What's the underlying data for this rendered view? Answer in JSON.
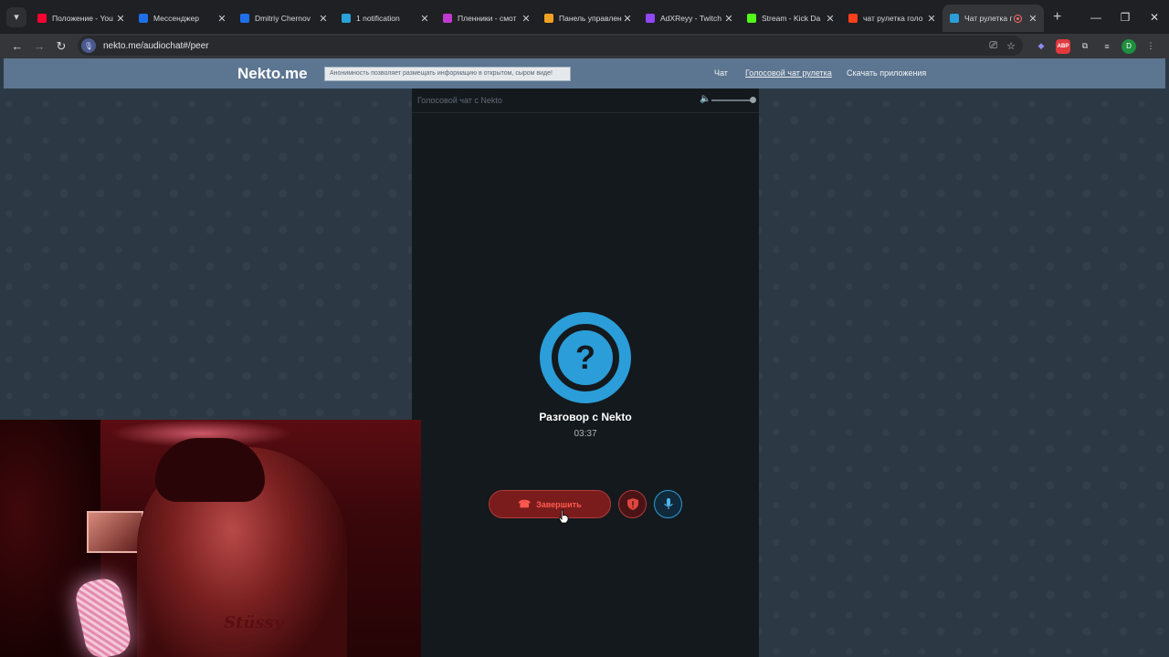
{
  "browser": {
    "tabs": [
      {
        "title": "Положение - You",
        "icon": "youtube-icon",
        "color": "#ff0033"
      },
      {
        "title": "Мессенджер",
        "icon": "messenger-icon",
        "color": "#1f6feb"
      },
      {
        "title": "Dmitriy Chernov",
        "icon": "messenger-icon",
        "color": "#1f6feb"
      },
      {
        "title": "1 notification",
        "icon": "telegram-icon",
        "color": "#2aa3d8"
      },
      {
        "title": "Пленники - смот",
        "icon": "video-icon",
        "color": "#c03ad0"
      },
      {
        "title": "Панель управлен",
        "icon": "donation-icon",
        "color": "#f0a020"
      },
      {
        "title": "AdXReyy - Twitch",
        "icon": "twitch-icon",
        "color": "#9146ff"
      },
      {
        "title": "Stream - Kick Da",
        "icon": "kick-icon",
        "color": "#53fc18"
      },
      {
        "title": "чат рулетка голо",
        "icon": "yandex-icon",
        "color": "#fc3f1d"
      },
      {
        "title": "Чат рулетка г",
        "icon": "nekto-icon",
        "color": "#2b9dd8",
        "active": true
      }
    ],
    "url": "nekto.me/audiochat#/peer"
  },
  "site": {
    "logo": "Nekto.me",
    "notice": "Анонимность позволяет размещать информацию в открытом, сыром виде!",
    "menu": [
      "Чат",
      "Голосовой чат рулетка",
      "Скачать приложения"
    ]
  },
  "chat": {
    "title": "Голосовой чат с Nekto",
    "peer_name": "Разговор с Nekto",
    "timer": "03:37",
    "end_label": "Завершить",
    "avatar_glyph": "?"
  },
  "webcam": {
    "shirt_text": "Stüssy"
  }
}
